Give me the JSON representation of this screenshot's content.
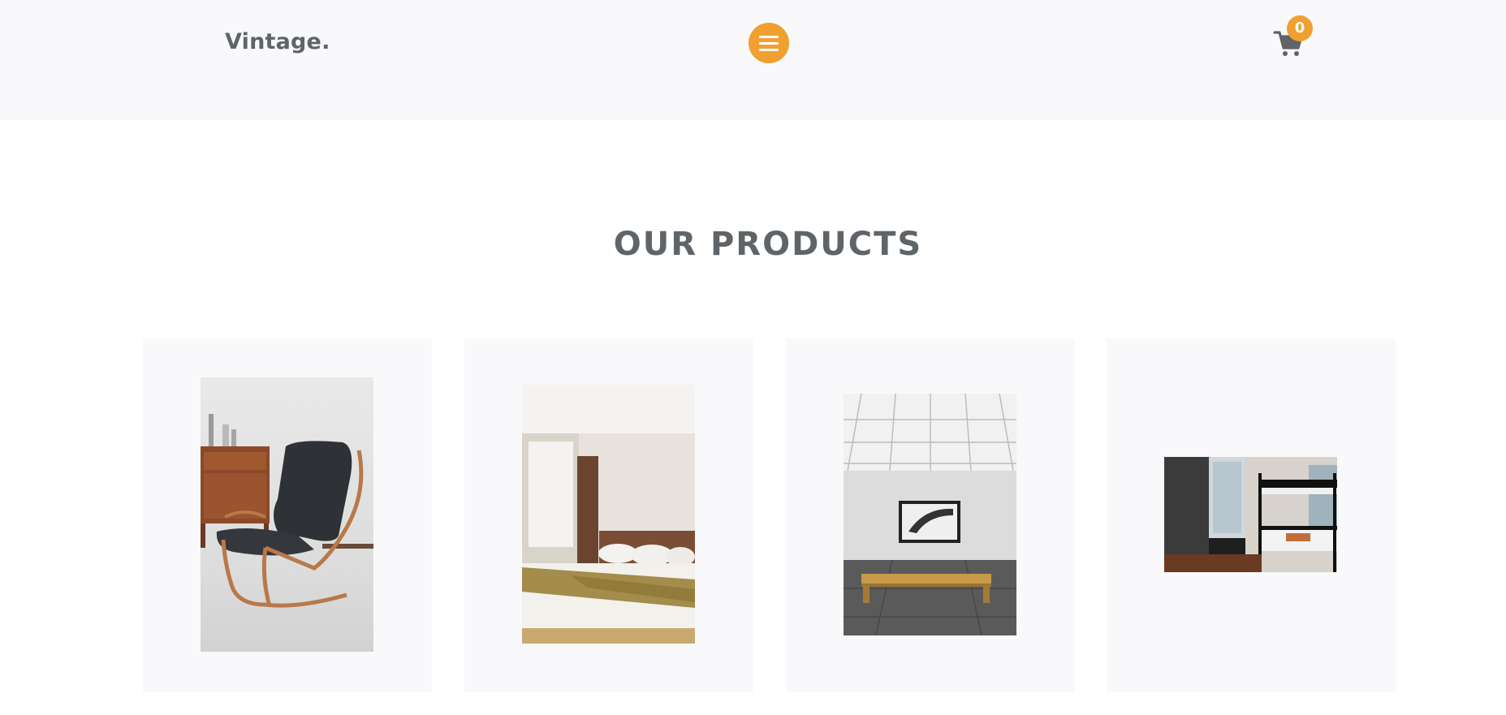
{
  "header": {
    "logo": "Vintage.",
    "menu_icon": "hamburger-icon",
    "cart_icon": "cart-icon",
    "cart_count": "0",
    "accent_color": "#f0a030"
  },
  "products_section": {
    "title": "OUR PRODUCTS",
    "products": [
      {
        "image": "black lounge chair with bentwood frame beside wooden cabinet"
      },
      {
        "image": "hotel bedroom with white bed and patterned runner"
      },
      {
        "image": "gallery room with framed picture and wooden bench"
      },
      {
        "image": "room with black metal bunk beds and window"
      }
    ]
  }
}
